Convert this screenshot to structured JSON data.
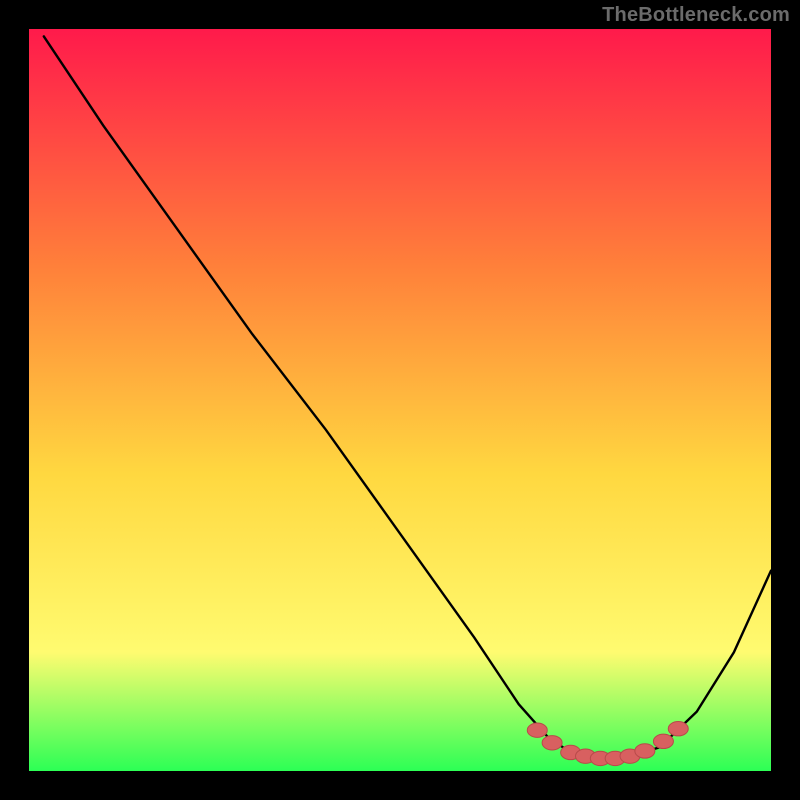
{
  "watermark": "TheBottleneck.com",
  "colors": {
    "gradient_top": "#ff1a4b",
    "gradient_mid_upper": "#ff803a",
    "gradient_mid": "#ffd840",
    "gradient_mid_lower": "#fffb70",
    "gradient_bottom": "#2cff55",
    "curve": "#000000",
    "marker_fill": "#d86060",
    "marker_stroke": "#b84a4a",
    "background": "#000000"
  },
  "chart_data": {
    "type": "line",
    "title": "",
    "xlabel": "",
    "ylabel": "",
    "xlim": [
      0,
      100
    ],
    "ylim": [
      0,
      100
    ],
    "grid": false,
    "legend": false,
    "series": [
      {
        "name": "bottleneck-curve",
        "x": [
          2,
          10,
          20,
          30,
          40,
          50,
          60,
          66,
          70,
          73,
          76,
          80,
          85,
          90,
          95,
          100
        ],
        "y": [
          99,
          87,
          73,
          59,
          46,
          32,
          18,
          9,
          4.5,
          2.5,
          1.7,
          1.7,
          3.2,
          8,
          16,
          27
        ]
      }
    ],
    "marker_cluster": {
      "description": "low-bottleneck region markers along curve minimum",
      "points": [
        {
          "x": 68.5,
          "y": 5.5
        },
        {
          "x": 70.5,
          "y": 3.8
        },
        {
          "x": 73.0,
          "y": 2.5
        },
        {
          "x": 75.0,
          "y": 2.0
        },
        {
          "x": 77.0,
          "y": 1.7
        },
        {
          "x": 79.0,
          "y": 1.7
        },
        {
          "x": 81.0,
          "y": 2.0
        },
        {
          "x": 83.0,
          "y": 2.7
        },
        {
          "x": 85.5,
          "y": 4.0
        },
        {
          "x": 87.5,
          "y": 5.7
        }
      ]
    }
  }
}
